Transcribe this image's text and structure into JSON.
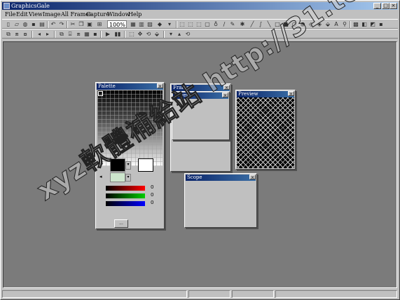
{
  "app": {
    "title": "GraphicsGale",
    "minimize": "_",
    "maximize": "□",
    "close": "×"
  },
  "menu": [
    "File",
    "Edit",
    "View",
    "Image",
    "All Frames",
    "Capture",
    "Window",
    "Help"
  ],
  "toolbar": {
    "zoom_value": "100%"
  },
  "panels": {
    "palette": {
      "title": "Palette",
      "close": "×",
      "button": "..."
    },
    "frame": {
      "title": "Frame",
      "close": "×"
    },
    "layer": {
      "title": "Layer",
      "close": "×"
    },
    "preview": {
      "title": "Preview",
      "close": "×"
    },
    "scope": {
      "title": "Scope",
      "close": "×"
    }
  },
  "rgb": {
    "r_value": "0",
    "g_value": "0",
    "b_value": "0"
  },
  "colors": {
    "accent_title": "#0a246a",
    "window_bg": "#c0c0c0",
    "workspace_bg": "#7b7b7b"
  },
  "icons": [
    "new-icon",
    "open-icon",
    "search-icon",
    "save-icon",
    "print-icon",
    "undo-icon",
    "redo-icon",
    "cut-icon",
    "copy-icon",
    "paste-icon",
    "zoom-icon",
    "grid-icon",
    "pen-icon",
    "line-icon",
    "rect-icon",
    "ellipse-icon",
    "fill-icon",
    "text-icon",
    "select-icon",
    "play-icon",
    "stop-icon"
  ],
  "watermark": "xyz軟體補給站 http://31.to"
}
